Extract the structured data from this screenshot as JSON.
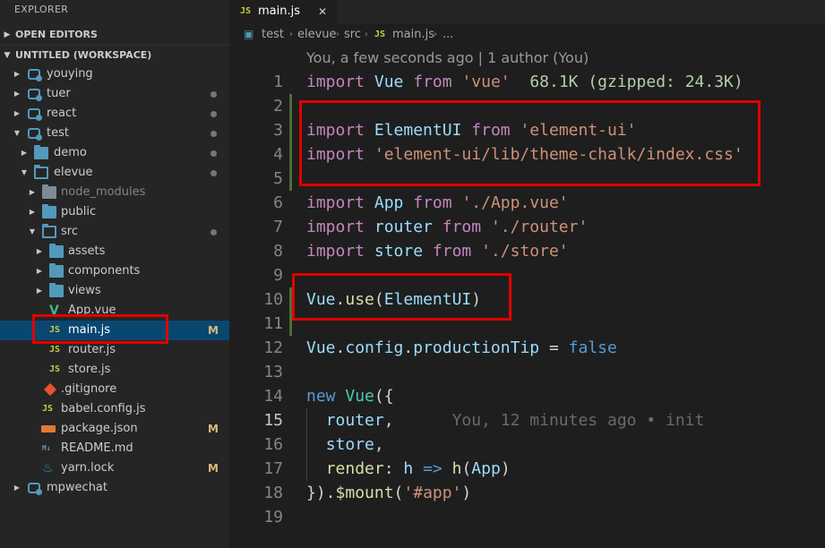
{
  "sidebar": {
    "title": "EXPLORER",
    "open_editors": "OPEN EDITORS",
    "workspace": "UNTITLED (WORKSPACE)",
    "tree": {
      "youying": "youying",
      "tuer": "tuer",
      "react": "react",
      "test": "test",
      "demo": "demo",
      "elevue": "elevue",
      "node_modules": "node_modules",
      "public": "public",
      "src": "src",
      "assets": "assets",
      "components": "components",
      "views": "views",
      "app_vue": "App.vue",
      "main_js": "main.js",
      "router_js": "router.js",
      "store_js": "store.js",
      "gitignore": ".gitignore",
      "babel_config": "babel.config.js",
      "package_json": "package.json",
      "readme": "README.md",
      "yarn_lock": "yarn.lock",
      "mpwechat": "mpwechat"
    },
    "badges": {
      "main_js": "M",
      "package_json": "M",
      "yarn_lock": "M"
    },
    "icons": {
      "js": "JS",
      "vue": "V",
      "md": "M↓",
      "yarn": "♨"
    }
  },
  "tab": {
    "label": "main.js",
    "icon": "JS",
    "close": "✕"
  },
  "breadcrumb": {
    "items": [
      "test",
      "elevue",
      "src",
      "main.js",
      "..."
    ],
    "icon": "JS"
  },
  "editor": {
    "codelens": "You, a few seconds ago | 1 author (You)",
    "line_numbers": [
      "1",
      "2",
      "3",
      "4",
      "5",
      "6",
      "7",
      "8",
      "9",
      "10",
      "11",
      "12",
      "13",
      "14",
      "15",
      "16",
      "17",
      "18",
      "19"
    ],
    "code": {
      "l1": {
        "kw": "import",
        "id": "Vue",
        "from": "from",
        "str": "'vue'",
        "size": "68.1K (gzipped: 24.3K)"
      },
      "l3": {
        "kw": "import",
        "id": "ElementUI",
        "from": "from",
        "str": "'element-ui'"
      },
      "l4": {
        "kw": "import",
        "str": "'element-ui/lib/theme-chalk/index.css'"
      },
      "l6": {
        "kw": "import",
        "id": "App",
        "from": "from",
        "str": "'./App.vue'"
      },
      "l7": {
        "kw": "import",
        "id": "router",
        "from": "from",
        "str": "'./router'"
      },
      "l8": {
        "kw": "import",
        "id": "store",
        "from": "from",
        "str": "'./store'"
      },
      "l10": {
        "obj": "Vue",
        "dot": ".",
        "fn": "use",
        "open": "(",
        "arg": "ElementUI",
        "close": ")"
      },
      "l12": {
        "obj": "Vue",
        "d1": ".",
        "p1": "config",
        "d2": ".",
        "p2": "productionTip",
        "eq": " = ",
        "val": "false"
      },
      "l14": {
        "kw": "new",
        "cls": "Vue",
        "rest": "({"
      },
      "l15": {
        "id": "router",
        "comma": ",",
        "blame": "You, 12 minutes ago • init"
      },
      "l16": {
        "id": "store",
        "comma": ","
      },
      "l17": {
        "id": "render",
        "colon": ": ",
        "arg": "h",
        "arrow": " => ",
        "fn": "h",
        "open": "(",
        "app": "App",
        "close": ")"
      },
      "l18": {
        "start": "}).",
        "fn": "$mount",
        "open": "(",
        "str": "'#app'",
        "close": ")"
      }
    }
  },
  "colors": {
    "highlight_box": "#e00000",
    "selection": "#094771",
    "modified": "#d7ba7d"
  }
}
